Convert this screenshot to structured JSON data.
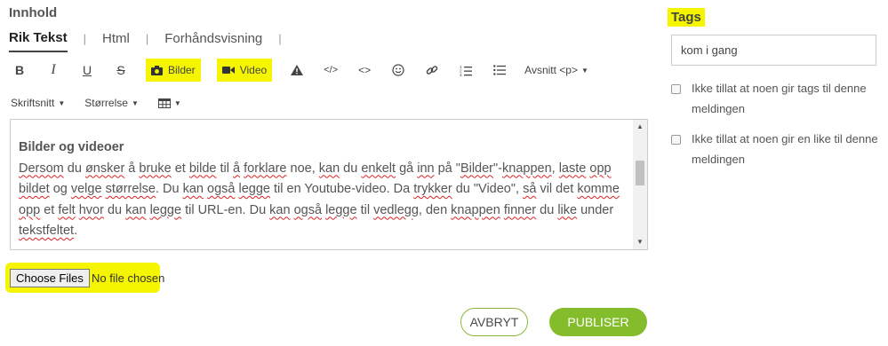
{
  "content": {
    "section_title": "Innhold",
    "tabs": [
      {
        "label": "Rik Tekst"
      },
      {
        "label": "Html"
      },
      {
        "label": "Forhåndsvisning"
      }
    ],
    "tab_separator": "|",
    "toolbar": {
      "bold": "B",
      "italic": "I",
      "underline": "U",
      "strike": "S",
      "images": "Bilder",
      "video": "Video",
      "code_block": "</>",
      "code_inline": "<>",
      "paragraph_dropdown": "Avsnitt <p>",
      "font_dropdown": "Skriftsnitt",
      "size_dropdown": "Størrelse"
    },
    "editor": {
      "heading": "Bilder og videoer",
      "line1_parts": [
        "Dersom",
        " du ",
        "ønsker",
        " å ",
        "bruke",
        " et ",
        "bilde",
        " til ",
        "å",
        " ",
        "forklare",
        " noe, ",
        "kan",
        " du ",
        "enkelt",
        " gå ",
        "inn",
        " på \"",
        "Bilder",
        "\"-",
        "knappen",
        ", ",
        "laste",
        " ",
        "opp"
      ],
      "line2_parts": [
        "bildet",
        " og ",
        "velge",
        " ",
        "størrelse",
        ". Du ",
        "kan",
        " ",
        "også",
        " ",
        "legge",
        " til en Youtube-video. Da ",
        "trykker",
        " du \"Video\", ",
        "så",
        " vil det ",
        "komme"
      ],
      "line3_parts": [
        "opp",
        " et ",
        "felt",
        " ",
        "hvor",
        " du ",
        "kan",
        " ",
        "legge",
        " til URL-en. Du ",
        "kan",
        " ",
        "også",
        " ",
        "legge",
        " til ",
        "vedlegg",
        ", den ",
        "knappen",
        " ",
        "finner",
        " du ",
        "like",
        " under"
      ],
      "line4_parts": [
        "tekstfeltet",
        "."
      ]
    },
    "file": {
      "button": "Choose Files",
      "status": "No file chosen"
    },
    "actions": {
      "cancel": "AVBRYT",
      "publish": "PUBLISER"
    }
  },
  "tags": {
    "title": "Tags",
    "input_value": "kom i gang",
    "options": [
      {
        "label": "Ikke tillat at noen gir tags til denne meldingen"
      },
      {
        "label": "Ikke tillat at noen gir en like til denne meldingen"
      }
    ]
  },
  "colors": {
    "highlight": "#f5f500",
    "accent_green": "#84bd2c",
    "spell_underline": "#e02020"
  },
  "icons": [
    "bold-icon",
    "italic-icon",
    "underline-icon",
    "strikethrough-icon",
    "camera-icon",
    "video-camera-icon",
    "warning-icon",
    "code-block-icon",
    "code-icon",
    "smiley-icon",
    "link-icon",
    "ordered-list-icon",
    "bullet-list-icon",
    "table-icon",
    "chevron-down-icon"
  ]
}
